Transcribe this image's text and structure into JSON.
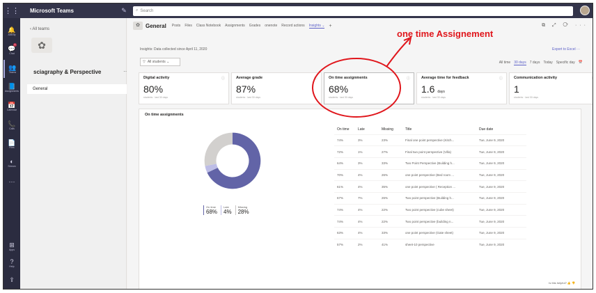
{
  "topbar": {
    "waffle_icon": "⋮⋮",
    "app_title": "Microsoft Teams",
    "compose_icon": "✎",
    "search_placeholder": "Search"
  },
  "rail": [
    {
      "icon": "🔔",
      "label": "Activity",
      "name": "activity-icon"
    },
    {
      "icon": "💬",
      "label": "Chat",
      "name": "chat-icon",
      "badge": "1"
    },
    {
      "icon": "👥",
      "label": "Teams",
      "name": "teams-icon",
      "active": true
    },
    {
      "icon": "📘",
      "label": "Assignments",
      "name": "assignments-icon"
    },
    {
      "icon": "📅",
      "label": "Calendar",
      "name": "calendar-icon"
    },
    {
      "icon": "📞",
      "label": "Calls",
      "name": "calls-icon"
    },
    {
      "icon": "📄",
      "label": "Files",
      "name": "files-icon"
    },
    {
      "icon": "◐",
      "label": "Stream",
      "name": "stream-icon"
    },
    {
      "icon": "···",
      "label": "",
      "name": "more-apps-icon"
    }
  ],
  "rail_bottom": [
    {
      "icon": "⊞",
      "label": "Apps",
      "name": "apps-icon"
    },
    {
      "icon": "?",
      "label": "Help",
      "name": "help-icon"
    },
    {
      "icon": "⇪",
      "label": "",
      "name": "feedback-icon"
    }
  ],
  "leftpanel": {
    "back_label": "All teams",
    "team_name": "sciagraphy & Perspective",
    "more": "···",
    "channel": "General"
  },
  "header": {
    "channel_title": "General",
    "tabs": [
      "Posts",
      "Files",
      "Class Notebook",
      "Assignments",
      "Grades",
      "onenote",
      "Record actions",
      "Insights ⌄"
    ],
    "active_tab": 7,
    "plus": "+",
    "icons": "⧉ ⤢ ⟳ ···"
  },
  "insights": {
    "data_note": "Insights: Data collected since April 11, 2020",
    "export_label": "Export to Excel   ···",
    "filter_label": "All students ⌄",
    "ranges": [
      "All time",
      "30 days",
      "7 days",
      "Today",
      "Specific day",
      "📅"
    ],
    "selected_range": 1
  },
  "cards": [
    {
      "title": "Digital activity",
      "value": "80%",
      "unit": "",
      "sub": "students · last 30 days"
    },
    {
      "title": "Average grade",
      "value": "87%",
      "unit": "",
      "sub": "students · last 30 days"
    },
    {
      "title": "On time assignments",
      "value": "68%",
      "unit": "",
      "sub": "students · last 30 days"
    },
    {
      "title": "Average time for feedback",
      "value": "1.6",
      "unit": "days",
      "sub": "students · last 30 days"
    },
    {
      "title": "Communication activity",
      "value": "1",
      "unit": "",
      "sub": "students · last 30 days"
    }
  ],
  "panel": {
    "title": "On time assignments",
    "donut": {
      "on_time": 68,
      "late": 4,
      "missing": 28,
      "colors": {
        "on_time": "#6264a7",
        "late": "#bdbde6",
        "missing": "#d2d0ce"
      }
    },
    "legend": [
      {
        "label": "On time",
        "value": "68%"
      },
      {
        "label": "Late",
        "value": "4%"
      },
      {
        "label": "Missing",
        "value": "28%"
      }
    ],
    "columns": [
      "On time",
      "Late",
      "Missing",
      "Title",
      "Due date"
    ],
    "rows": [
      [
        "74%",
        "3%",
        "23%",
        "Final one point perspective (Kitch...",
        "Tue, June 9, 2020"
      ],
      [
        "72%",
        "1%",
        "27%",
        "Final two point perspective (Villa)",
        "Tue, June 9, 2020"
      ],
      [
        "64%",
        "3%",
        "33%",
        "Two Point Perspective (Building h...",
        "Tue, June 9, 2020"
      ],
      [
        "70%",
        "4%",
        "26%",
        "one point perspective (Bed room ...",
        "Tue, June 9, 2020"
      ],
      [
        "61%",
        "4%",
        "35%",
        "one point perspective ( Reception ...",
        "Tue, June 9, 2020"
      ],
      [
        "67%",
        "7%",
        "26%",
        "Two point perspective (Building h...",
        "Tue, June 9, 2020"
      ],
      [
        "74%",
        "4%",
        "22%",
        "Two point perspective (cube sheet)",
        "Tue, June 9, 2020"
      ],
      [
        "74%",
        "4%",
        "22%",
        "Two point perspective (building n...",
        "Tue, June 9, 2020"
      ],
      [
        "63%",
        "4%",
        "33%",
        "one point perspective (Gate sheet)",
        "Tue, June 9, 2020"
      ],
      [
        "57%",
        "2%",
        "41%",
        "sheet-10 perspective",
        "Tue, June 9, 2020"
      ]
    ],
    "helpful": "Is this helpful? 👍 👎"
  },
  "annotation": {
    "text": "one time Assignement",
    "color": "#e0161c"
  }
}
